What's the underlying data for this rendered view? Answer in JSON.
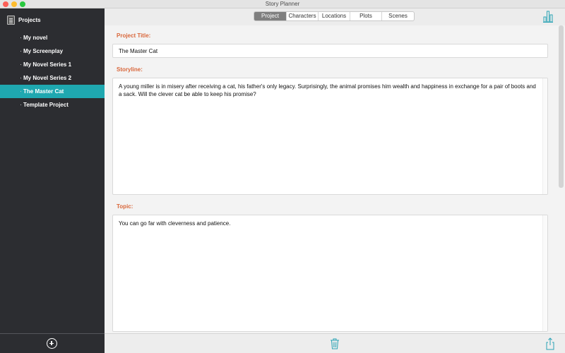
{
  "window": {
    "title": "Story Planner"
  },
  "colors": {
    "accent": "#1fa8b0",
    "label": "#d9673b",
    "sidebar_bg": "#2c2d31"
  },
  "sidebar": {
    "header_icon": "projects-icon",
    "header_label": "Projects",
    "items": [
      {
        "label": "My novel",
        "selected": false
      },
      {
        "label": "My Screenplay",
        "selected": false
      },
      {
        "label": "My Novel Series 1",
        "selected": false
      },
      {
        "label": "My Novel Series 2",
        "selected": false
      },
      {
        "label": "The Master Cat",
        "selected": true
      },
      {
        "label": "Template Project",
        "selected": false
      }
    ],
    "footer_icon": "add-circle-icon"
  },
  "toolbar": {
    "tabs": [
      {
        "label": "Project",
        "active": true
      },
      {
        "label": "Characters",
        "active": false
      },
      {
        "label": "Locations",
        "active": false
      },
      {
        "label": "Plots",
        "active": false
      },
      {
        "label": "Scenes",
        "active": false
      }
    ],
    "right_icon": "bar-chart-icon"
  },
  "form": {
    "title_label": "Project Title:",
    "title_value": "The Master Cat",
    "storyline_label": "Storyline:",
    "storyline_value": "A young miller is in misery after receiving a cat, his father's only legacy. Surprisingly, the animal promises him wealth and happiness in exchange for a pair of boots and a sack. Will the clever cat be able to keep his promise?",
    "topic_label": "Topic:",
    "topic_value": "You can go far with cleverness and patience."
  },
  "bottombar": {
    "delete_icon": "trash-icon",
    "share_icon": "share-icon"
  }
}
